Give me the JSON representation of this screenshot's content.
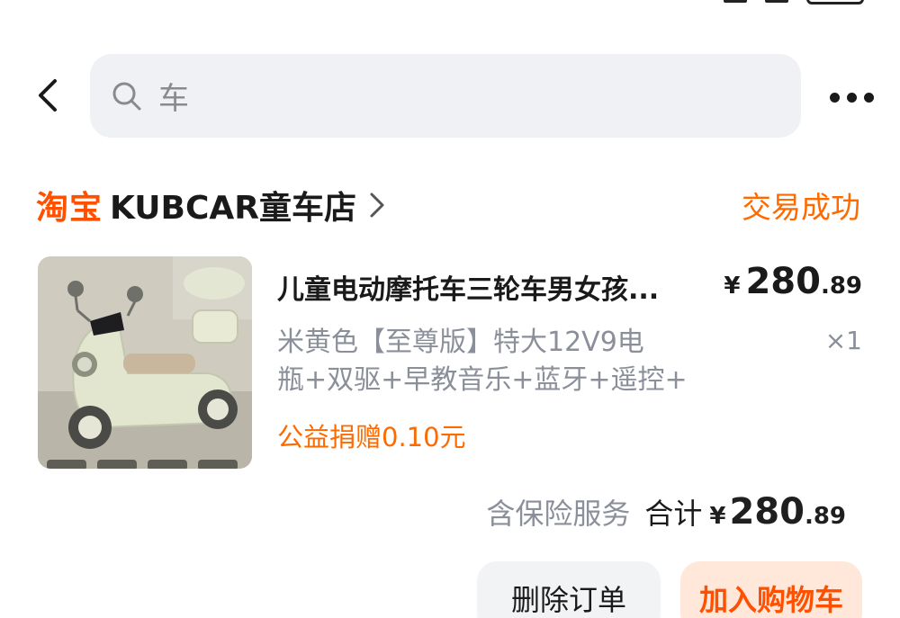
{
  "header": {
    "search_value": "车"
  },
  "shop": {
    "brand": "淘宝",
    "name": "KUBCAR童车店",
    "status": "交易成功"
  },
  "item": {
    "title": "儿童电动摩托车三轮车男女孩...",
    "price_currency": "¥",
    "price_int": "280",
    "price_dec": ".89",
    "variant_line1": "米黄色【至尊版】特大12V9电",
    "variant_line2": "瓶+双驱+早教音乐+蓝牙+遥控+",
    "quantity": "×1",
    "donation": "公益捐赠0.10元",
    "image_icon": "kids-electric-tricycle-photo"
  },
  "summary": {
    "insurance": "含保险服务",
    "total_label": "合计",
    "currency": "¥",
    "total_int": "280",
    "total_dec": ".89"
  },
  "actions": {
    "delete_label": "删除订单",
    "cart_label": "加入购物车"
  },
  "colors": {
    "accent": "#ff5000",
    "status": "#ff6a00",
    "muted": "#8a8f99"
  }
}
